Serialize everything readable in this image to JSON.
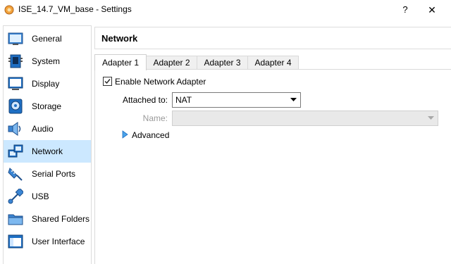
{
  "window": {
    "title": "ISE_14.7_VM_base - Settings",
    "help_glyph": "?",
    "close_glyph": "✕"
  },
  "sidebar": {
    "selected_index": 5,
    "items": [
      {
        "label": "General",
        "icon": "general-icon"
      },
      {
        "label": "System",
        "icon": "system-icon"
      },
      {
        "label": "Display",
        "icon": "display-icon"
      },
      {
        "label": "Storage",
        "icon": "storage-icon"
      },
      {
        "label": "Audio",
        "icon": "audio-icon"
      },
      {
        "label": "Network",
        "icon": "network-icon"
      },
      {
        "label": "Serial Ports",
        "icon": "serial-ports-icon"
      },
      {
        "label": "USB",
        "icon": "usb-icon"
      },
      {
        "label": "Shared Folders",
        "icon": "shared-folders-icon"
      },
      {
        "label": "User Interface",
        "icon": "user-interface-icon"
      }
    ]
  },
  "section": {
    "title": "Network"
  },
  "tabs": [
    {
      "label": "Adapter 1",
      "active": true
    },
    {
      "label": "Adapter 2",
      "active": false
    },
    {
      "label": "Adapter 3",
      "active": false
    },
    {
      "label": "Adapter 4",
      "active": false
    }
  ],
  "adapter": {
    "enable_label": "Enable Network Adapter",
    "enabled": true,
    "attached_to_label": "Attached to:",
    "attached_to_value": "NAT",
    "name_label": "Name:",
    "name_value": "",
    "advanced_label": "Advanced"
  },
  "colors": {
    "selection": "#cce8ff",
    "icon_blue": "#1e6fc4"
  }
}
